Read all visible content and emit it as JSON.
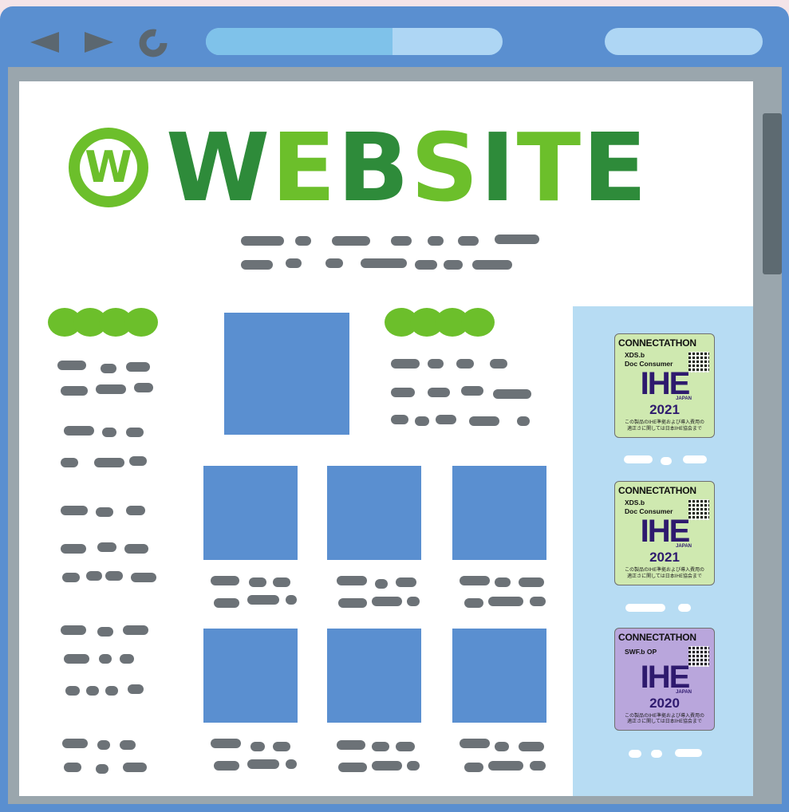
{
  "browser": {
    "back_icon": "back-arrow-icon",
    "forward_icon": "forward-arrow-icon",
    "reload_icon": "reload-icon",
    "load_progress": 0.63
  },
  "site": {
    "logo_letter": "W",
    "title": "WEBSITE"
  },
  "badges": [
    {
      "title": "CONNECTATHON",
      "line1": "XDS.b",
      "line2": "Doc Consumer",
      "logo": "IHE",
      "region": "JAPAN",
      "year": "2021",
      "note1": "この製品のIHE準拠および導入費用の",
      "note2": "適正さに関しては日本IHE協会まで",
      "color": "#cfe9b0"
    },
    {
      "title": "CONNECTATHON",
      "line1": "XDS.b",
      "line2": "Doc Consumer",
      "logo": "IHE",
      "region": "JAPAN",
      "year": "2021",
      "note1": "この製品のIHE準拠および導入費用の",
      "note2": "適正さに関しては日本IHE協会まで",
      "color": "#cfe9b0"
    },
    {
      "title": "CONNECTATHON",
      "line1": "SWF.b OP",
      "line2": "",
      "logo": "IHE",
      "region": "JAPAN",
      "year": "2020",
      "note1": "この製品のIHE準拠および導入費用の",
      "note2": "適正さに関しては日本IHE協会まで",
      "color": "#b9a6dc"
    }
  ],
  "colors": {
    "browser_frame": "#5a8fd0",
    "logo_dark_green": "#2e8b3a",
    "logo_light_green": "#6cbf2b",
    "sidebar": "#b7dcf3"
  }
}
